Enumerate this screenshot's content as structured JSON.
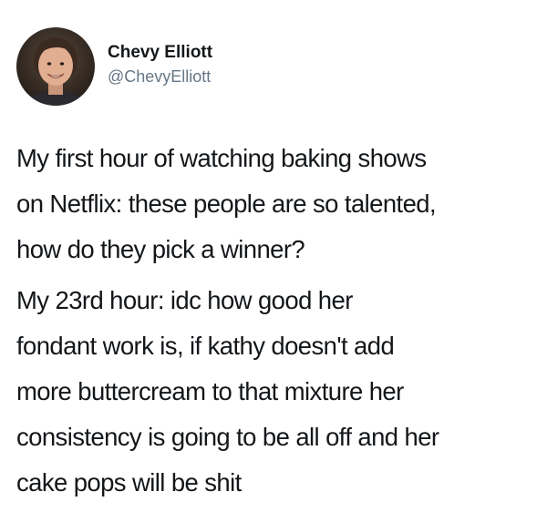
{
  "tweet": {
    "author": {
      "display_name": "Chevy Elliott",
      "handle": "@ChevyElliott",
      "avatar_icon": "profile-photo"
    },
    "paragraphs": [
      "My first hour of watching baking shows\non Netflix: these people are so talented,\nhow do they pick a winner?",
      "My 23rd hour: idc how good her\nfondant work is, if kathy doesn't add\nmore buttercream to that mixture her\nconsistency is going to be all off and her\ncake pops will be shit"
    ]
  }
}
